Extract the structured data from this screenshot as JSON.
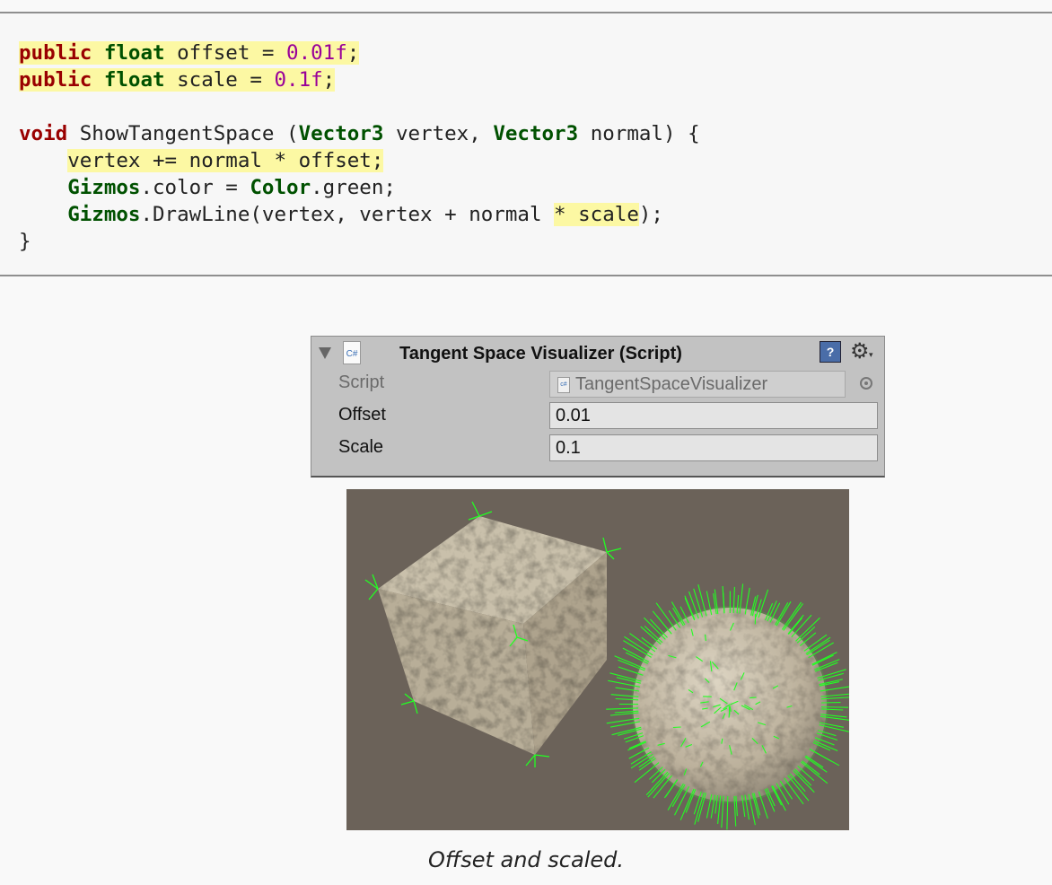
{
  "code": {
    "lines": [
      [
        {
          "t": "public",
          "c": "kw hl"
        },
        {
          "t": " ",
          "c": "hl"
        },
        {
          "t": "float",
          "c": "ty hl"
        },
        {
          "t": " offset = ",
          "c": "hl"
        },
        {
          "t": "0.01f",
          "c": "num hl"
        },
        {
          "t": ";",
          "c": "hl"
        }
      ],
      [
        {
          "t": "public",
          "c": "kw hl"
        },
        {
          "t": " ",
          "c": "hl"
        },
        {
          "t": "float",
          "c": "ty hl"
        },
        {
          "t": " scale = ",
          "c": "hl"
        },
        {
          "t": "0.1f",
          "c": "num hl"
        },
        {
          "t": ";",
          "c": "hl"
        }
      ],
      [],
      [
        {
          "t": "void",
          "c": "kw"
        },
        {
          "t": " ShowTangentSpace (",
          "c": ""
        },
        {
          "t": "Vector3",
          "c": "ty"
        },
        {
          "t": " vertex, ",
          "c": ""
        },
        {
          "t": "Vector3",
          "c": "ty"
        },
        {
          "t": " normal) {",
          "c": ""
        }
      ],
      [
        {
          "t": "    ",
          "c": ""
        },
        {
          "t": "vertex += normal * offset;",
          "c": "hl"
        }
      ],
      [
        {
          "t": "    ",
          "c": ""
        },
        {
          "t": "Gizmos",
          "c": "ty"
        },
        {
          "t": ".color = ",
          "c": ""
        },
        {
          "t": "Color",
          "c": "ty"
        },
        {
          "t": ".green;",
          "c": ""
        }
      ],
      [
        {
          "t": "    ",
          "c": ""
        },
        {
          "t": "Gizmos",
          "c": "ty"
        },
        {
          "t": ".DrawLine(vertex, vertex + normal ",
          "c": ""
        },
        {
          "t": "* scale",
          "c": "hl"
        },
        {
          "t": ");",
          "c": ""
        }
      ],
      [
        {
          "t": "}",
          "c": ""
        }
      ]
    ]
  },
  "inspector": {
    "title": "Tangent Space Visualizer (Script)",
    "cs_icon_label": "C#",
    "help_icon": "?",
    "gear_icon": "⚙",
    "gear_caret": "▾",
    "rows": {
      "script": {
        "label": "Script",
        "value": "TangentSpaceVisualizer"
      },
      "offset": {
        "label": "Offset",
        "value": "0.01"
      },
      "scale": {
        "label": "Scale",
        "value": "0.1"
      }
    }
  },
  "scene": {
    "background": "#6b6259",
    "surface_color": "#bdb3a0",
    "gizmo_color": "#22ff22"
  },
  "caption": "Offset and scaled."
}
